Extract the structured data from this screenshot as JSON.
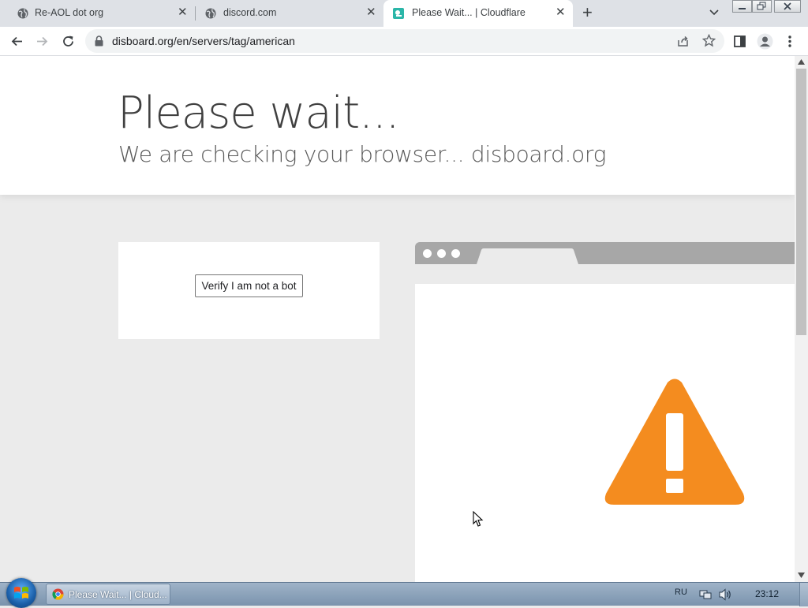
{
  "tabs": [
    {
      "title": "Re-AOL dot org",
      "icon": "globe-icon",
      "active": false
    },
    {
      "title": "discord.com",
      "icon": "globe-icon",
      "active": false
    },
    {
      "title": "Please Wait... | Cloudflare",
      "icon": "cloudflare-icon",
      "active": true
    }
  ],
  "address_bar": {
    "url": "disboard.org/en/servers/tag/american"
  },
  "page": {
    "heading": "Please wait...",
    "subheading": "We are checking your browser... disboard.org",
    "verify_button": "Verify I am not a bot"
  },
  "taskbar": {
    "task_label": "Please Wait... | Cloud...",
    "language": "RU",
    "time": "23:12"
  },
  "colors": {
    "warning": "#f48c1f",
    "page_background": "#ebebeb",
    "illustration_bar": "#a7a7a7"
  }
}
